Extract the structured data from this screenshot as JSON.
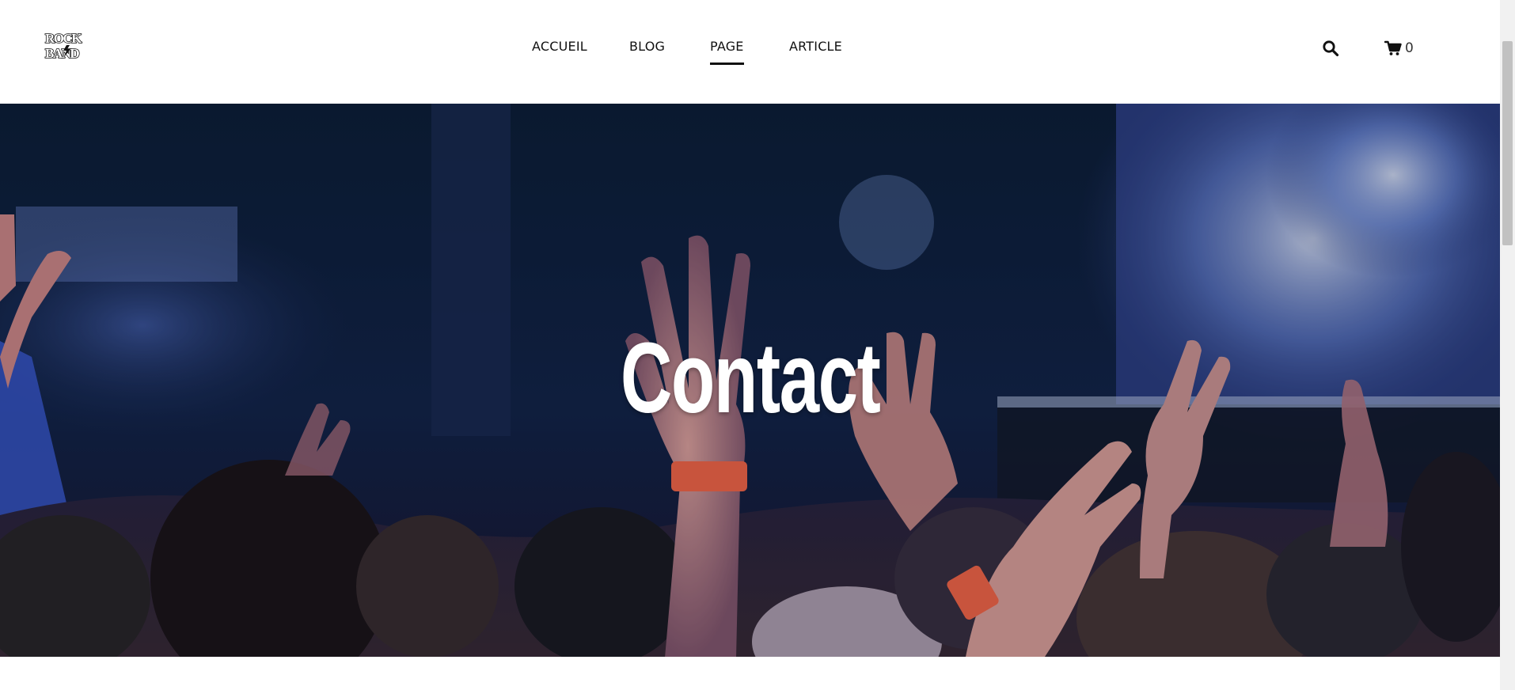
{
  "brand": {
    "logo_top": "ROCK",
    "logo_bottom": "BAND"
  },
  "nav": {
    "items": [
      {
        "label": "ACCUEIL"
      },
      {
        "label": "BLOG"
      },
      {
        "label": "PAGE",
        "active": true
      },
      {
        "label": "ARTICLE"
      }
    ]
  },
  "header_actions": {
    "search_icon": "search-icon",
    "cart_icon": "cart-icon",
    "cart_count": "0"
  },
  "hero": {
    "title": "Contact",
    "image": "concert crowd with raised hands"
  },
  "colors": {
    "text": "#111111",
    "hero_text": "#ffffff",
    "hero_bg": "#0b1a2e"
  }
}
